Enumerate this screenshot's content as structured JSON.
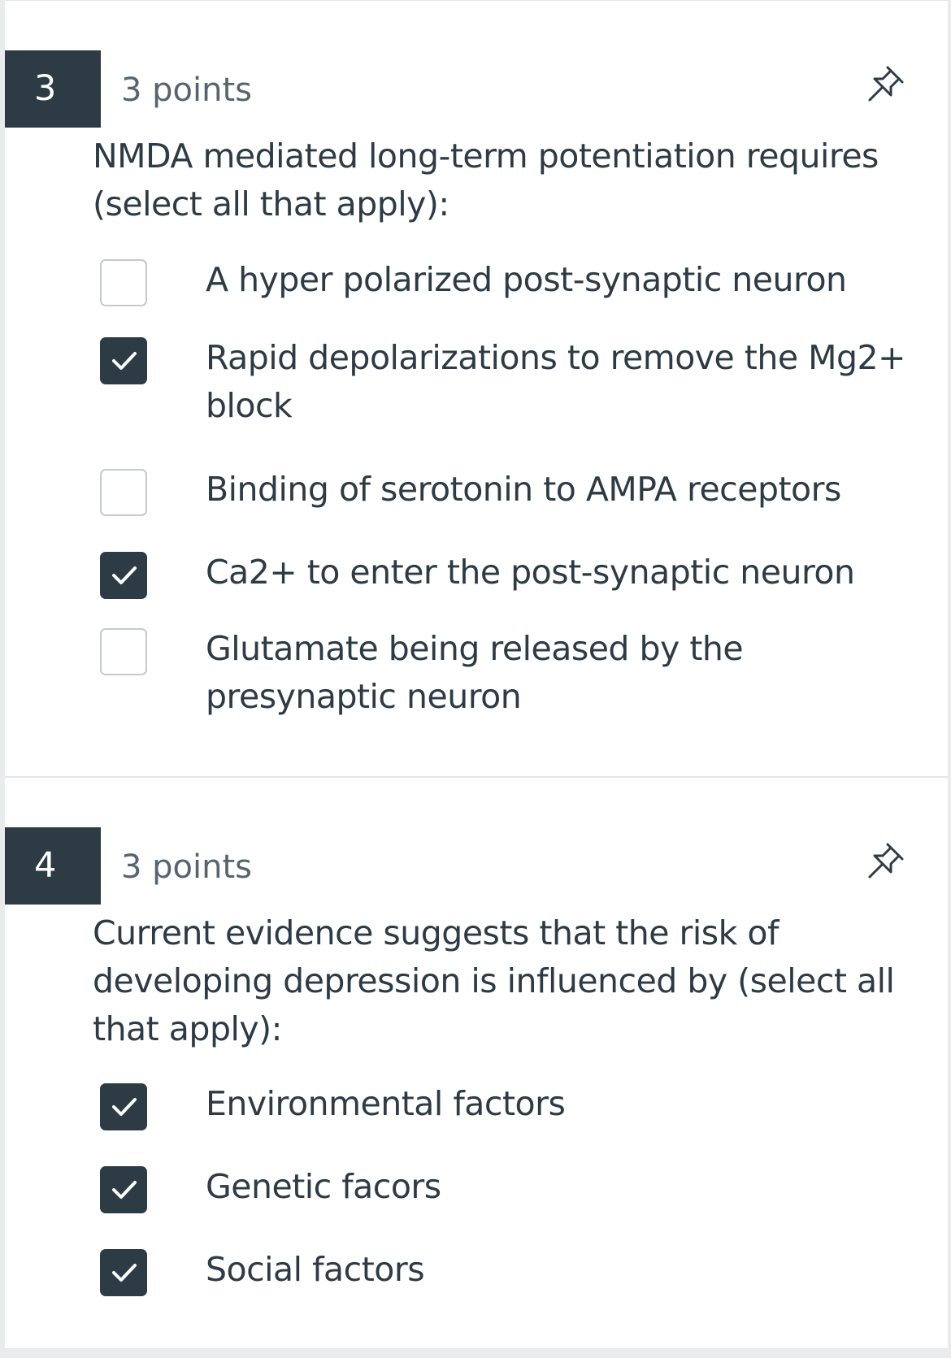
{
  "questions": [
    {
      "number": "3",
      "points": "3 points",
      "icon": "pin-icon",
      "text": "NMDA mediated long-term potentiation requires (select all that apply):",
      "options": [
        {
          "label": "A hyper polarized post-synaptic neuron",
          "checked": false
        },
        {
          "label": "Rapid depolarizations to remove the Mg2+ block",
          "checked": true
        },
        {
          "label": "Binding of serotonin to AMPA receptors",
          "checked": false
        },
        {
          "label": "Ca2+ to enter the post-synaptic neuron",
          "checked": true
        },
        {
          "label": "Glutamate being released by the presynaptic neuron",
          "checked": false
        }
      ]
    },
    {
      "number": "4",
      "points": "3 points",
      "icon": "pin-icon",
      "text": "Current evidence suggests that the risk of developing depression is influenced by (select all that apply):",
      "options": [
        {
          "label": "Environmental factors",
          "checked": true
        },
        {
          "label": "Genetic facors",
          "checked": true
        },
        {
          "label": "Social factors",
          "checked": true
        }
      ]
    }
  ],
  "colors": {
    "accent": "#2d3b45",
    "muted": "#566470",
    "border": "#c4cacf",
    "background": "#ffffff"
  }
}
